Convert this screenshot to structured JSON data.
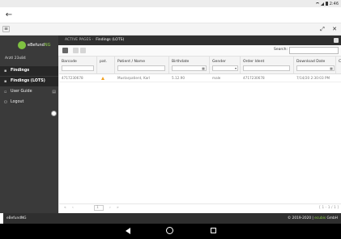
{
  "status": {
    "time": "2:46"
  },
  "app": {
    "back_icon": "back-arrow-icon"
  },
  "browser": {
    "menu_icon": "hamburger-icon",
    "fullscreen_icon": "expand-icon",
    "close_icon": "close-icon"
  },
  "sidebar": {
    "logo_prefix": "eBefund",
    "logo_suffix": "NG",
    "account": "Arztl 23x84",
    "items": [
      {
        "label": "Findings",
        "icon": "folder-icon",
        "active": true
      },
      {
        "label": "Findings (LOTS)",
        "icon": "folder-icon",
        "active": true
      },
      {
        "label": "User Guide",
        "icon": "book-icon",
        "active": false
      },
      {
        "label": "Logout",
        "icon": "logout-icon",
        "active": false
      }
    ]
  },
  "breadcrumb": {
    "root": "ACTIVE PAGES -",
    "current": "Findings (LOTS)"
  },
  "toolbar": {
    "search_label": "Search:",
    "search_value": ""
  },
  "table": {
    "columns": [
      "Barcode",
      "pat.",
      "Patient / Name",
      "Birthdate",
      "Gender",
      "Order Ident",
      "Download Date",
      "C"
    ],
    "rows": [
      {
        "barcode": "4717230678",
        "patient": "Mustarpatient, Karl",
        "birthdate": "5.12.90",
        "gender": "male",
        "order": "4717230678",
        "download": "7/14/20 2:30:03 PM"
      }
    ],
    "pager": {
      "page": "1",
      "info": "[ 1 - 1 / 1 ]"
    }
  },
  "footer": {
    "left": "eBefundNG",
    "right_prefix": "© 2019-2020 |",
    "right_brand": "ecubis",
    "right_suffix": "GmbH"
  },
  "colors": {
    "accent": "#7fc241",
    "sidebar": "#3a3a3a",
    "warn": "#f2a020"
  }
}
